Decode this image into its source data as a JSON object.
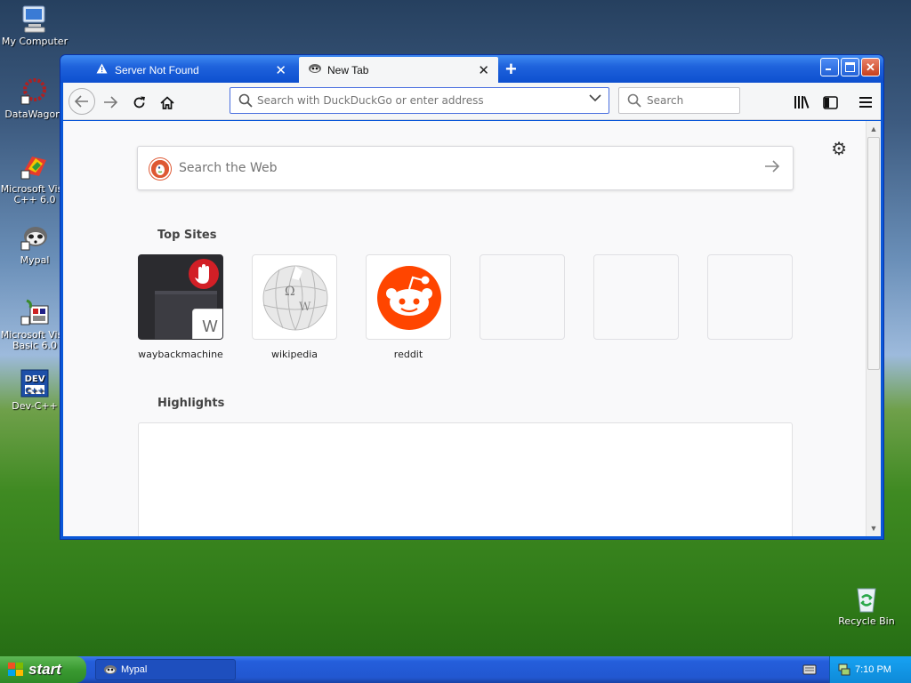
{
  "desktop": {
    "icons": [
      {
        "label": "My Computer"
      },
      {
        "label": "DataWagon."
      },
      {
        "label": "Microsoft Visu C++ 6.0"
      },
      {
        "label": "Mypal"
      },
      {
        "label": "Microsoft Visu Basic 6.0"
      },
      {
        "label": "Dev-C++"
      },
      {
        "label": "Recycle Bin"
      }
    ]
  },
  "browser": {
    "tabs": [
      {
        "title": "Server Not Found"
      },
      {
        "title": "New Tab"
      }
    ],
    "url_placeholder": "Search with DuckDuckGo or enter address",
    "search_placeholder": "Search",
    "newtab": {
      "websearch_placeholder": "Search the Web",
      "top_sites_heading": "Top Sites",
      "highlights_heading": "Highlights",
      "top_sites": [
        {
          "label": "waybackmachine",
          "tile_letter": "W"
        },
        {
          "label": "wikipedia"
        },
        {
          "label": "reddit"
        }
      ]
    }
  },
  "taskbar": {
    "start_label": "start",
    "task_label": "Mypal",
    "clock": "7:10 PM"
  },
  "colors": {
    "reddit": "#ff4500",
    "duckduckgo": "#de5833",
    "accent": "#0a58d8"
  }
}
